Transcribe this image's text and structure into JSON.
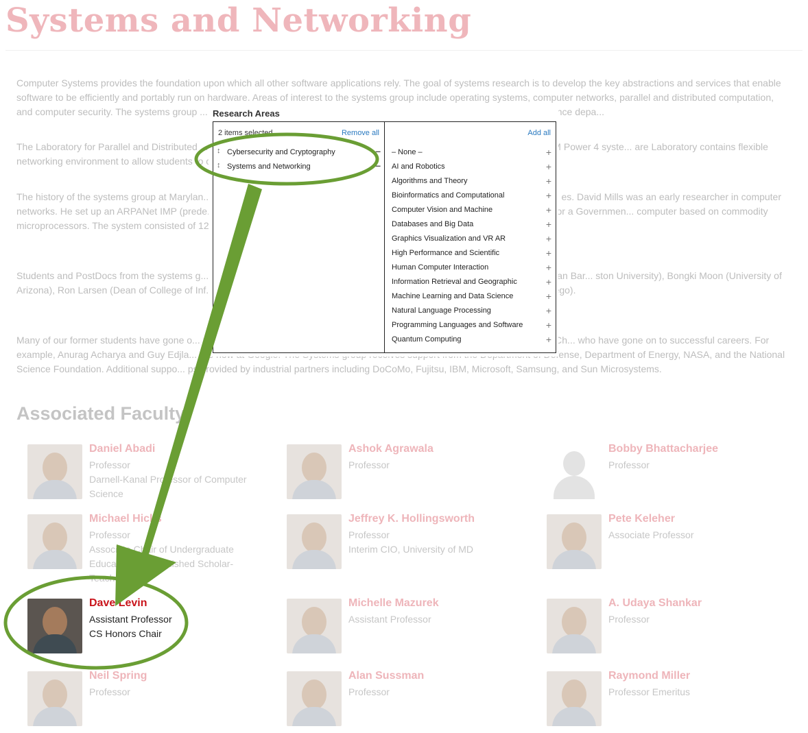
{
  "page": {
    "title": "Systems and Networking"
  },
  "intro": {
    "p1": "Computer Systems provides the foundation upon which all other software applications rely. The goal of systems research is to develop the key abstractions and services that enable software to be efficiently and portably run on hardware. Areas of interest to the systems group include operating systems, computer networks, parallel and distributed computation, and computer security. The systems group ... experimental work, the group maintains several laboratories in the Computer Science depa...",
    "p2": "The Laboratory for Parallel and Distributed ... search. Current equipment includes a 24 processor SPARC SMP, 8 processor IBM Power 4 syste... are Laboratory contains flexible networking environment to allow students to configure ... cludes about 20 machines to support experiments.",
    "p3": "The history of the systems group at Marylan... he book Computer Organization and Microprogramming which was the first maj... es. David Mills was an early researcher in computer networks. He set up an ARPANet IMP (prede... ter). At the time, this was the only full ARPANet node not located at a University or a Governmen... computer based on commodity microprocessors. The system consisted of 128 Z-80 processor...",
    "p4": "Students and PostDocs from the systems g... students in faculty positions include: Gagan Agrawal (Ohio State University), Suman Bar... ston University), Bongki Moon (University of Arizona), Ron Larsen (Dean of College of Inf... n (University of Maryland), and Aaron Schulman (University of California San Diego).",
    "p5": "Many of our former students have gone o... n Lee), Google (Ruggero Morselli), and IBM T.J.Watson (Henrique Andrade, I-Hsin Ch... who have gone on to successful careers. For example, Anurag Acharya and Guy Edjla... are now at Google. The Systems group receives support from the Department of Defense, Department of Energy, NASA, and the National Science Foundation. Additional suppo... ps provided by industrial partners including DoCoMo, Fujitsu, IBM, Microsoft, Samsung, and Sun Microsystems."
  },
  "faculty": {
    "heading": "Associated Faculty",
    "members": [
      {
        "name": "Daniel Abadi",
        "lines": [
          "Professor",
          "Darnell-Kanal Professor of Computer",
          "Science"
        ]
      },
      {
        "name": "Ashok Agrawala",
        "lines": [
          "Professor"
        ]
      },
      {
        "name": "Bobby Bhattacharjee",
        "lines": [
          "Professor"
        ]
      },
      {
        "name": "Michael Hicks",
        "lines": [
          "Professor",
          "Associate Chair of Undergraduate",
          "Education, Distinguished Scholar-",
          "Teacher"
        ]
      },
      {
        "name": "Jeffrey K. Hollingsworth",
        "lines": [
          "Professor",
          "Interim CIO, University of MD"
        ]
      },
      {
        "name": "Pete Keleher",
        "lines": [
          "Associate Professor"
        ]
      },
      {
        "name": "Dave Levin",
        "lines": [
          "Assistant Professor",
          "CS Honors Chair"
        ]
      },
      {
        "name": "Michelle Mazurek",
        "lines": [
          "Assistant Professor"
        ]
      },
      {
        "name": "A. Udaya Shankar",
        "lines": [
          "Professor"
        ]
      },
      {
        "name": "Neil Spring",
        "lines": [
          "Professor"
        ]
      },
      {
        "name": "Alan Sussman",
        "lines": [
          "Professor"
        ]
      },
      {
        "name": "Raymond Miller",
        "lines": [
          "Professor Emeritus"
        ]
      }
    ]
  },
  "research_areas": {
    "label": "Research Areas",
    "selected_count": "2 items selected",
    "remove_all": "Remove all",
    "add_all": "Add all",
    "selected": [
      "Cybersecurity and Cryptography",
      "Systems and Networking"
    ],
    "available": [
      "– None –",
      "AI and Robotics",
      "Algorithms and Theory",
      "Bioinformatics and Computational",
      "Computer Vision and Machine",
      "Databases and Big Data",
      "Graphics Visualization and VR AR",
      "High Performance and Scientific",
      "Human Computer Interaction",
      "Information Retrieval and Geographic",
      "Machine Learning and Data Science",
      "Natural Language Processing",
      "Programming Languages and Software",
      "Quantum Computing"
    ],
    "drag_glyph": "↕",
    "minus_glyph": "–",
    "plus_glyph": "+"
  },
  "annotation": {
    "color": "#6a9e34"
  }
}
